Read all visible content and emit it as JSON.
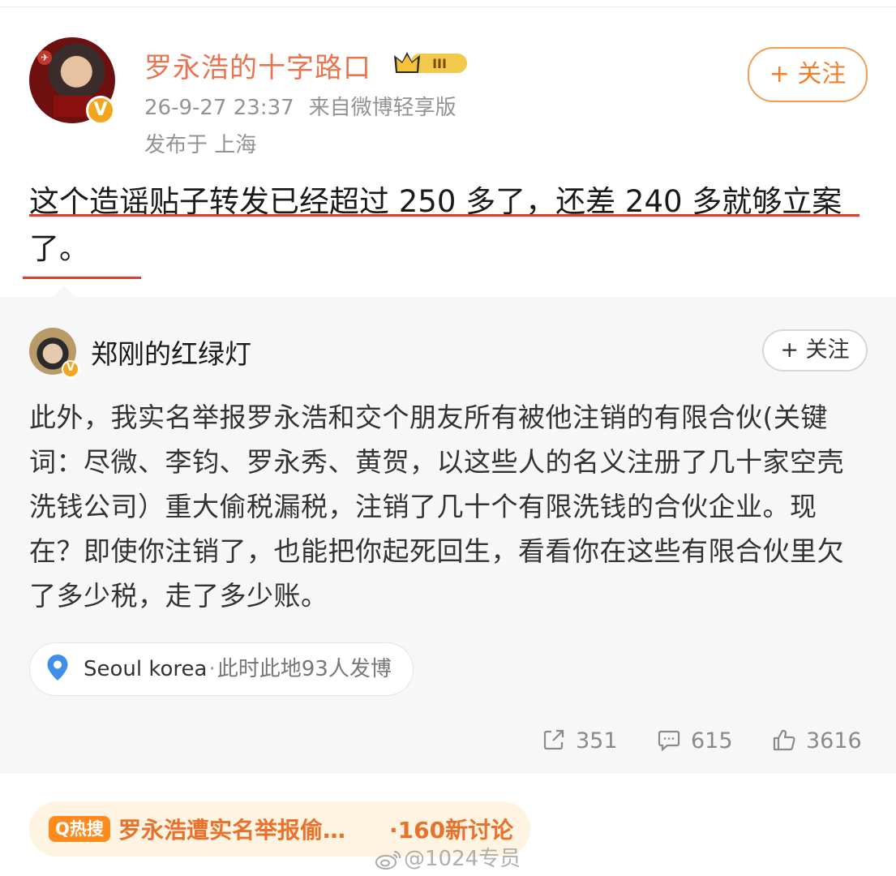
{
  "post": {
    "author": "罗永浩的十字路口",
    "member_badge": "III",
    "timestamp": "26-9-27 23:37",
    "source": "来自微博轻享版",
    "location_line": "发布于 上海",
    "follow_label": "+ 关注",
    "text": "这个造谣贴子转发已经超过 250 多了，还差 240 多就够立案了。"
  },
  "retweet": {
    "author": "郑刚的红绿灯",
    "follow_label": "+ 关注",
    "text": "此外，我实名举报罗永浩和交个朋友所有被他注销的有限合伙(关键词：尽微、李钧、罗永秀、黄贺，以这些人的名义注册了几十家空壳洗钱公司）重大偷税漏税，注销了几十个有限洗钱的合伙企业。现在？即使你注销了，也能把你起死回生，看看你在这些有限合伙里欠了多少税，走了多少账。",
    "location": {
      "city": "Seoul korea",
      "separator": "·",
      "count_text": "此时此地93人发博"
    },
    "stats": {
      "reposts": "351",
      "comments": "615",
      "likes": "3616"
    }
  },
  "hot_search": {
    "badge": "Q热搜",
    "title": "罗永浩遭实名举报偷…",
    "count": "·160新讨论"
  },
  "watermark": "@1024专员",
  "colors": {
    "accent_orange": "#eb7350",
    "underline_red": "#e23a2c",
    "verified_gold": "#f3a51d",
    "card_bg": "#f7f7f7"
  }
}
